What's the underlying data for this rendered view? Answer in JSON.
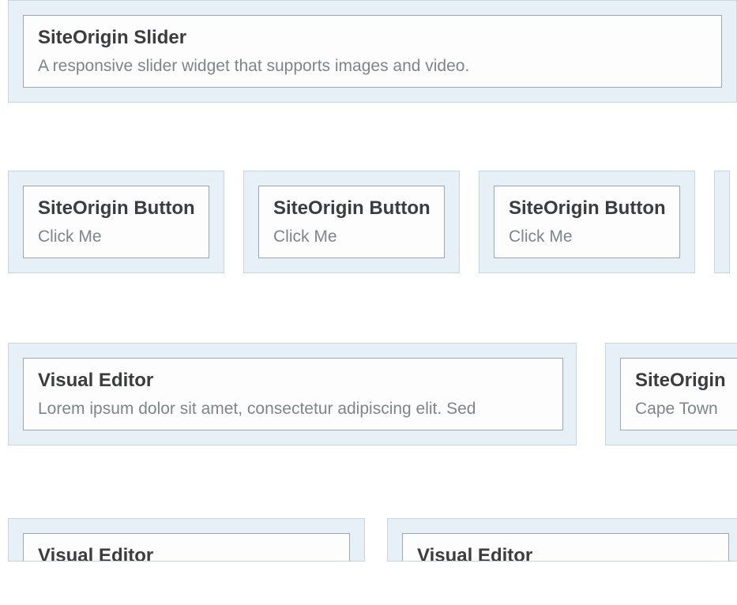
{
  "rows": {
    "slider": {
      "title": "SiteOrigin Slider",
      "desc": "A responsive slider widget that supports images and video."
    },
    "buttons": [
      {
        "title": "SiteOrigin Button",
        "desc": "Click Me"
      },
      {
        "title": "SiteOrigin Button",
        "desc": "Click Me"
      },
      {
        "title": "SiteOrigin Button",
        "desc": "Click Me"
      }
    ],
    "editor": {
      "title": "Visual Editor",
      "desc": "Lorem ipsum dolor sit amet, consectetur adipiscing elit. Sed"
    },
    "siteorigin_partial": {
      "title": "SiteOrigin",
      "desc": "Cape Town"
    },
    "bottom_editors": [
      {
        "title": "Visual Editor"
      },
      {
        "title": "Visual Editor"
      }
    ]
  }
}
